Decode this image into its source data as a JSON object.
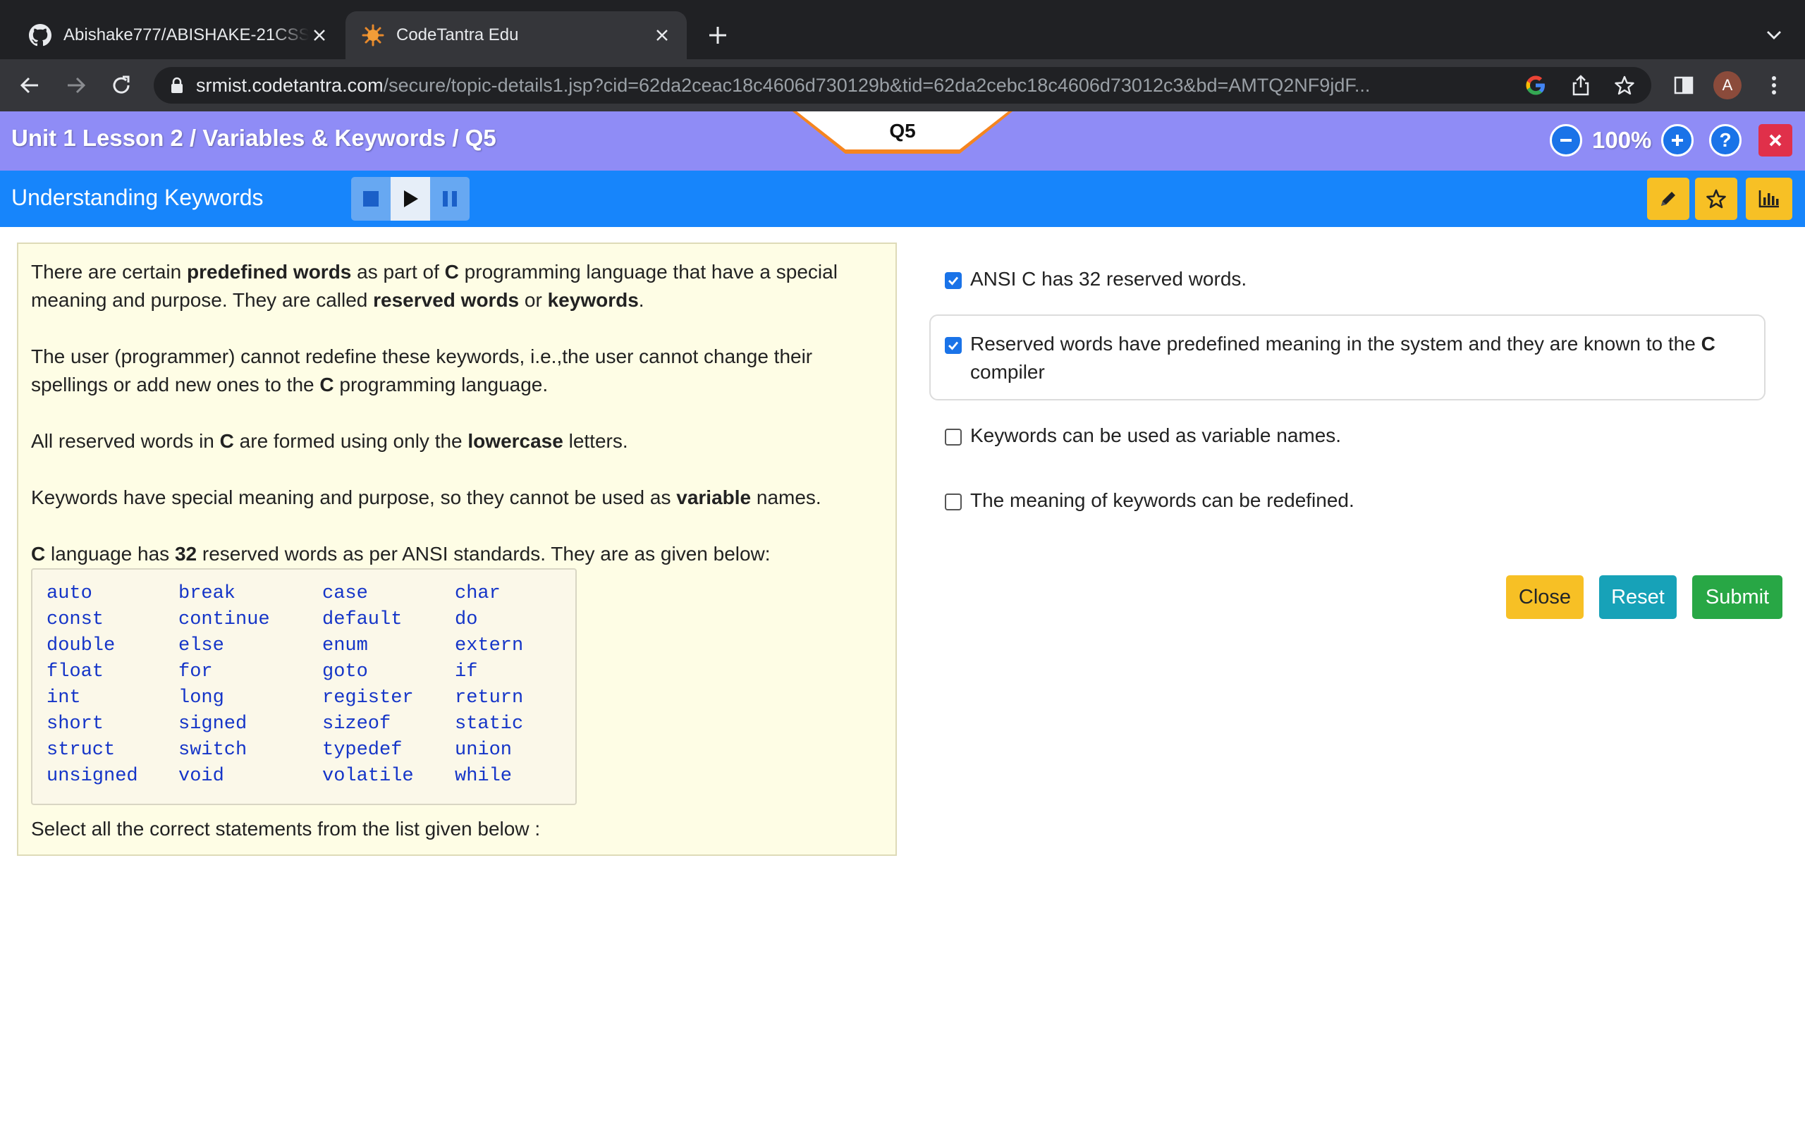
{
  "browser": {
    "tabs": [
      {
        "title": "Abishake777/ABISHAKE-21CSS101J",
        "favicon": "github-icon",
        "active": false
      },
      {
        "title": "CodeTantra Edu",
        "favicon": "codetantra-sun-icon",
        "active": true
      }
    ],
    "url_host": "srmist.codetantra.com",
    "url_path": "/secure/topic-details1.jsp?cid=62da2ceac18c4606d730129b&tid=62da2cebc18c4606d73012c3&bd=AMTQ2NF9jdF...",
    "profile_initial": "A"
  },
  "header": {
    "breadcrumb": "Unit 1 Lesson 2 / Variables & Keywords / Q5",
    "question_tab": "Q5",
    "zoom": "100%",
    "lesson_title": "Understanding Keywords"
  },
  "content": {
    "p1": {
      "a": "There are certain ",
      "b": "predefined words",
      "c": " as part of ",
      "d": "C",
      "e": " programming language that have a special meaning and purpose. They are called ",
      "f": "reserved words",
      "g": " or ",
      "h": "keywords",
      "i": "."
    },
    "p2": {
      "a": "The user (programmer) cannot redefine these keywords, i.e.,the user cannot change their spellings or add new ones to the ",
      "b": "C",
      "c": " programming language."
    },
    "p3": {
      "a": "All reserved words in ",
      "b": "C",
      "c": " are formed using only the ",
      "d": "lowercase",
      "e": " letters."
    },
    "p4": {
      "a": "Keywords have special meaning and purpose, so they cannot be used as ",
      "b": "variable",
      "c": " names."
    },
    "p5": {
      "a": "C",
      "b": " language has ",
      "c": "32",
      "d": " reserved words as per ANSI standards. They are as given below:"
    },
    "keywords": [
      [
        "auto",
        "break",
        "case",
        "char"
      ],
      [
        "const",
        "continue",
        "default",
        "do"
      ],
      [
        "double",
        "else",
        "enum",
        "extern"
      ],
      [
        "float",
        "for",
        "goto",
        "if"
      ],
      [
        "int",
        "long",
        "register",
        "return"
      ],
      [
        "short",
        "signed",
        "sizeof",
        "static"
      ],
      [
        "struct",
        "switch",
        "typedef",
        "union"
      ],
      [
        "unsigned",
        "void",
        "volatile",
        "while"
      ]
    ],
    "instruction": "Select all the correct statements from the list given below :"
  },
  "options": [
    {
      "text": "ANSI C has 32 reserved words.",
      "checked": true
    },
    {
      "text_a": "Reserved words have predefined meaning in the system and they are known to the ",
      "text_b": "C",
      "text_c": " compiler",
      "checked": true
    },
    {
      "text": "Keywords can be used as variable names.",
      "checked": false
    },
    {
      "text": "The meaning of keywords can be redefined.",
      "checked": false
    }
  ],
  "actions": {
    "close": "Close",
    "reset": "Reset",
    "submit": "Submit"
  },
  "colors": {
    "purple_bar": "#8f8cf6",
    "blue_bar": "#1785fb",
    "tab_orange": "#f5851f",
    "content_bg": "#fefde5",
    "keyword_blue": "#1535c8",
    "btn_yellow": "#f7c025",
    "btn_teal": "#17a2b8",
    "btn_green": "#28a745",
    "close_red": "#e0304a"
  }
}
